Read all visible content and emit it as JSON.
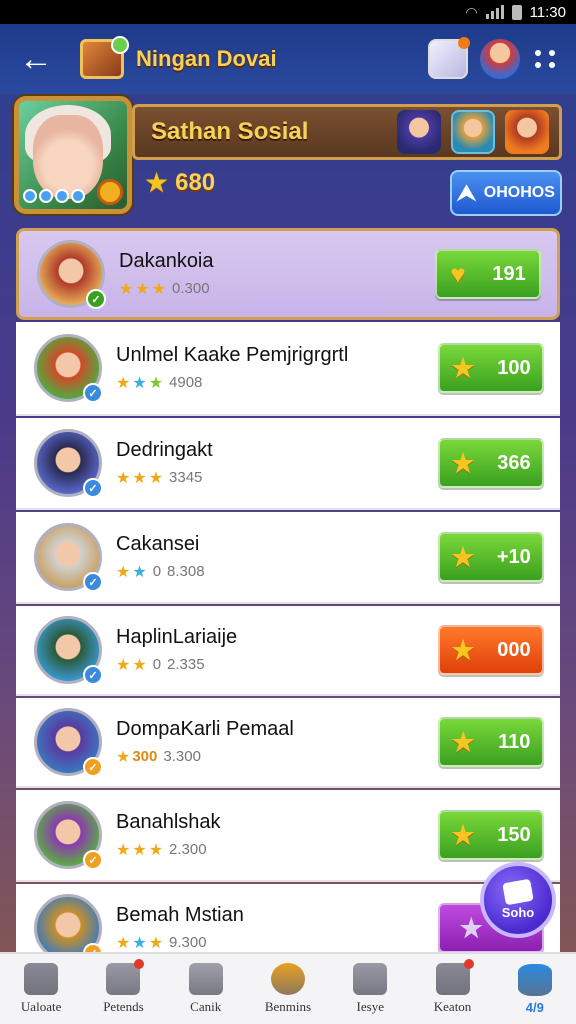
{
  "status_bar": {
    "time": "11:30"
  },
  "header": {
    "title": "Ningan Dovai"
  },
  "profile": {
    "player_name": "Sathan Sosial",
    "score": "680",
    "action_label": "OHOHOS"
  },
  "rows": [
    {
      "name": "Dakankoia",
      "stars_text": "",
      "value": "0.300",
      "pill_value": "191",
      "pill_color": "green",
      "highlight": true,
      "avatar_colors": [
        "#b03a2a",
        "#e8b25a"
      ],
      "badge_color": "#3aa020",
      "badge_glyph": "✓"
    },
    {
      "name": "Unlmel Kaake Pemjrigrgrtl",
      "stars_text": "",
      "value": "4908",
      "pill_value": "100",
      "pill_color": "green",
      "avatar_colors": [
        "#d04a2a",
        "#4ab040"
      ],
      "badge_color": "#3a8ae0",
      "badge_glyph": "✓"
    },
    {
      "name": "Dedringakt",
      "stars_text": "",
      "value": "3345",
      "pill_value": "366",
      "pill_color": "green",
      "avatar_colors": [
        "#2a2a50",
        "#5a6ad0"
      ],
      "badge_color": "#3a8ae0",
      "badge_glyph": "✓"
    },
    {
      "name": "Cakansei",
      "stars_text": "0",
      "value": "8.308",
      "pill_value": "+10",
      "pill_color": "green",
      "avatar_colors": [
        "#d0d0d0",
        "#c8a060"
      ],
      "badge_color": "#3a8ae0",
      "badge_glyph": "✓"
    },
    {
      "name": "HaplinLariaije",
      "stars_text": "0",
      "value": "2.335",
      "pill_value": "000",
      "pill_color": "orange",
      "avatar_colors": [
        "#2a5a3a",
        "#3a9ad0"
      ],
      "badge_color": "#3a8ae0",
      "badge_glyph": "✓"
    },
    {
      "name": "DompaKarli Pemaal",
      "stars_text": "300",
      "value": "3.300",
      "pill_value": "110",
      "pill_color": "green",
      "avatar_colors": [
        "#5a3aa0",
        "#3a7ac0"
      ],
      "badge_color": "#f0a020",
      "badge_glyph": "✓"
    },
    {
      "name": "Banahlshak",
      "stars_text": "",
      "value": "2.300",
      "pill_value": "150",
      "pill_color": "green",
      "avatar_colors": [
        "#8a3ab0",
        "#5ab040"
      ],
      "badge_color": "#f0a020",
      "badge_glyph": "✓"
    },
    {
      "name": "Bemah Mstian",
      "stars_text": "",
      "value": "9.300",
      "pill_value": "",
      "pill_color": "purple",
      "avatar_colors": [
        "#c8902a",
        "#3a7ac0"
      ],
      "badge_color": "#f0a020",
      "badge_glyph": "✓"
    }
  ],
  "fab": {
    "label": "Soho"
  },
  "nav": [
    {
      "label": "Ualoate",
      "icon": "stack-icon"
    },
    {
      "label": "Petends",
      "icon": "bell-icon"
    },
    {
      "label": "Canik",
      "icon": "shield-icon"
    },
    {
      "label": "Benmins",
      "icon": "badge-icon"
    },
    {
      "label": "Iesye",
      "icon": "home-icon"
    },
    {
      "label": "Keaton",
      "icon": "gear-icon"
    },
    {
      "label": "4/9",
      "icon": "database-icon",
      "active": true
    }
  ]
}
